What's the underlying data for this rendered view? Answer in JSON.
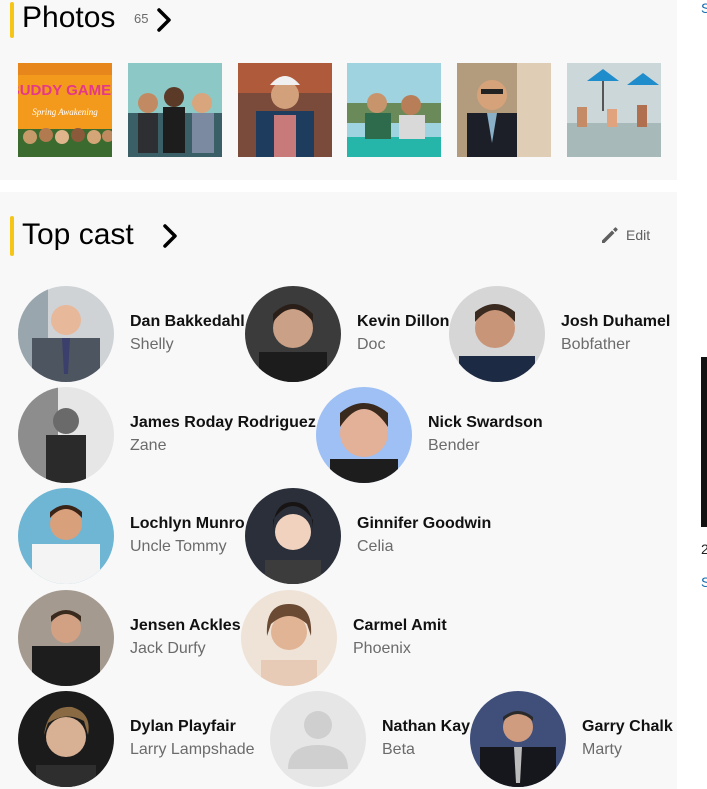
{
  "photos": {
    "title": "Photos",
    "count": "65",
    "thumbnails": [
      {
        "alt": "Buddy Games Spring Awakening poster",
        "poster_title": "BUDDY GAMES",
        "poster_subtitle": "Spring Awakening"
      },
      {
        "alt": "Group photo at pool party"
      },
      {
        "alt": "Man in white cap and patterned robe"
      },
      {
        "alt": "Men seated at outdoor table"
      },
      {
        "alt": "Man in suit at party"
      },
      {
        "alt": "Pool deck with umbrellas"
      }
    ]
  },
  "cast": {
    "title": "Top cast",
    "edit_label": "Edit",
    "members": [
      {
        "name": "Dan Bakkedahl",
        "role": "Shelly"
      },
      {
        "name": "Kevin Dillon",
        "role": "Doc"
      },
      {
        "name": "Josh Duhamel",
        "role": "Bobfather"
      },
      {
        "name": "James Roday Rodriguez",
        "role": "Zane"
      },
      {
        "name": "Nick Swardson",
        "role": "Bender"
      },
      {
        "name": "Lochlyn Munro",
        "role": "Uncle Tommy"
      },
      {
        "name": "Ginnifer Goodwin",
        "role": "Celia"
      },
      {
        "name": "Jensen Ackles",
        "role": "Jack Durfy"
      },
      {
        "name": "Carmel Amit",
        "role": "Phoenix"
      },
      {
        "name": "Dylan Playfair",
        "role": "Larry Lampshade"
      },
      {
        "name": "Nathan Kay",
        "role": "Beta"
      },
      {
        "name": "Garry Chalk",
        "role": "Marty"
      }
    ]
  },
  "sidebar": {
    "link_top": "S",
    "text_mid": "2",
    "link_bottom": "S"
  },
  "colors": {
    "accent": "#f5c518",
    "link": "#136cb2",
    "panel_bg": "#f8f8f8"
  }
}
